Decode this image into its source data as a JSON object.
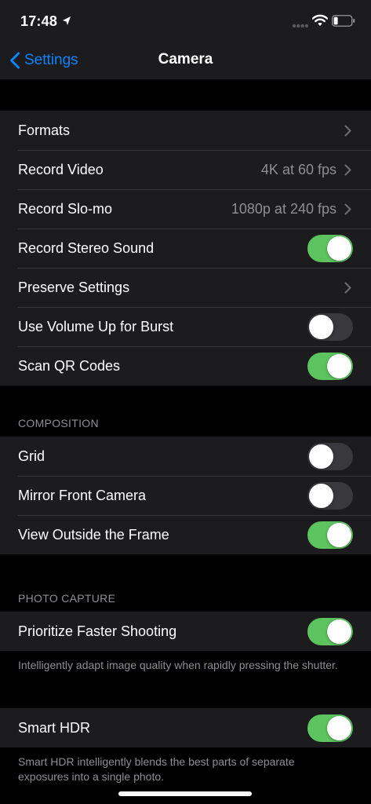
{
  "status_bar": {
    "time": "17:48",
    "icons": [
      "location-arrow-icon",
      "cellular-signal-icon",
      "wifi-icon",
      "battery-icon"
    ]
  },
  "nav": {
    "back_label": "Settings",
    "title": "Camera"
  },
  "colors": {
    "accent": "#0a84ff",
    "toggle_on": "#5cc35f",
    "toggle_off": "#39393d",
    "cell_bg": "#1c1c1e",
    "secondary_text": "#8e8e93"
  },
  "main_group": [
    {
      "label": "Formats",
      "type": "disclosure",
      "value": ""
    },
    {
      "label": "Record Video",
      "type": "disclosure",
      "value": "4K at 60 fps"
    },
    {
      "label": "Record Slo-mo",
      "type": "disclosure",
      "value": "1080p at 240 fps"
    },
    {
      "label": "Record Stereo Sound",
      "type": "toggle",
      "on": true
    },
    {
      "label": "Preserve Settings",
      "type": "disclosure",
      "value": ""
    },
    {
      "label": "Use Volume Up for Burst",
      "type": "toggle",
      "on": false
    },
    {
      "label": "Scan QR Codes",
      "type": "toggle",
      "on": true
    }
  ],
  "composition": {
    "header": "COMPOSITION",
    "rows": [
      {
        "label": "Grid",
        "type": "toggle",
        "on": false
      },
      {
        "label": "Mirror Front Camera",
        "type": "toggle",
        "on": false
      },
      {
        "label": "View Outside the Frame",
        "type": "toggle",
        "on": true
      }
    ]
  },
  "photo_capture": {
    "header": "PHOTO CAPTURE",
    "prioritize": {
      "label": "Prioritize Faster Shooting",
      "type": "toggle",
      "on": true
    },
    "prioritize_footer": "Intelligently adapt image quality when rapidly pressing the shutter.",
    "smart_hdr": {
      "label": "Smart HDR",
      "type": "toggle",
      "on": true
    },
    "smart_hdr_footer": "Smart HDR intelligently blends the best parts of separate exposures into a single photo."
  }
}
